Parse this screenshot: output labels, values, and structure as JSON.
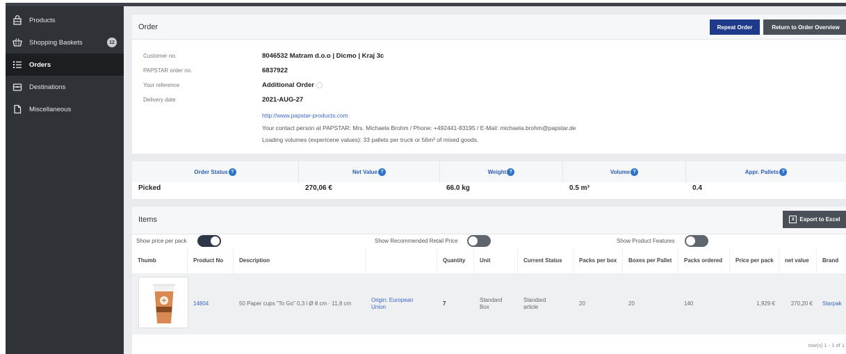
{
  "sidebar": {
    "items": [
      {
        "label": "Products",
        "icon": "bag-icon"
      },
      {
        "label": "Shopping Baskets",
        "icon": "basket-icon",
        "badge": "12"
      },
      {
        "label": "Orders",
        "icon": "list-icon",
        "active": true
      },
      {
        "label": "Destinations",
        "icon": "box-icon"
      },
      {
        "label": "Miscellaneous",
        "icon": "document-icon"
      }
    ]
  },
  "order": {
    "title": "Order",
    "repeat_label": "Repeat Order",
    "return_label": "Return to Order Overview",
    "fields": [
      {
        "label": "Customer no.",
        "value": "8046532 Matram d.o.o | Dicmo | Kraj 3c"
      },
      {
        "label": "PAPSTAR order no.",
        "value": "6837922"
      },
      {
        "label": "Your reference",
        "value": "Additional Order"
      },
      {
        "label": "Delivery date",
        "value": "2021-AUG-27"
      }
    ],
    "url": "http://www.papstar-products.com",
    "contact": "Your contact person at PAPSTAR: Mrs. Michaela Brohm / Phone: +492441-83195 / E-Mail: michaela.brohm@papstar.de",
    "loading": "Loading volumes (expericene values): 33 pallets per truck or 56m³ of mixed goods."
  },
  "status": {
    "headers": [
      "Order Status",
      "Net Value",
      "Weight",
      "Volume",
      "Appr. Pallets"
    ],
    "values": [
      "Picked",
      "270,06 €",
      "66.0 kg",
      "0.5 m³",
      "0.4"
    ]
  },
  "items": {
    "title": "Items",
    "export_label": "Export to Excel",
    "toggles": [
      {
        "label": "Show price per pack",
        "on": true
      },
      {
        "label": "Show Recommended Retail Price",
        "on": false
      },
      {
        "label": "Show Product Features",
        "on": false
      }
    ],
    "columns": [
      "Thumb",
      "Product No",
      "Description",
      "",
      "Quantity",
      "Unit",
      "Current Status",
      "Packs per box",
      "Boxes per Pallet",
      "Packs ordered",
      "Price per pack",
      "net value",
      "Brand"
    ],
    "rows": [
      {
        "product_no": "14804",
        "description": "50 Paper cups \"To Go\" 0,3 l Ø 8 cm · 11,8 cm",
        "origin": "Origin: European Union",
        "quantity": "7",
        "unit": "Standard Box",
        "status": "Standard article",
        "packs_per_box": "20",
        "boxes_per_pallet": "20",
        "packs_ordered": "140",
        "price_per_pack": "1,929 €",
        "net_value": "270,20 €",
        "brand": "Starpak"
      }
    ],
    "footer": "row(s) 1 - 1 of 1"
  },
  "colors": {
    "sidebar_bg": "#2f3236",
    "primary_button": "#1f3a8a",
    "secondary_button": "#4b5058",
    "link": "#3a66c4"
  }
}
